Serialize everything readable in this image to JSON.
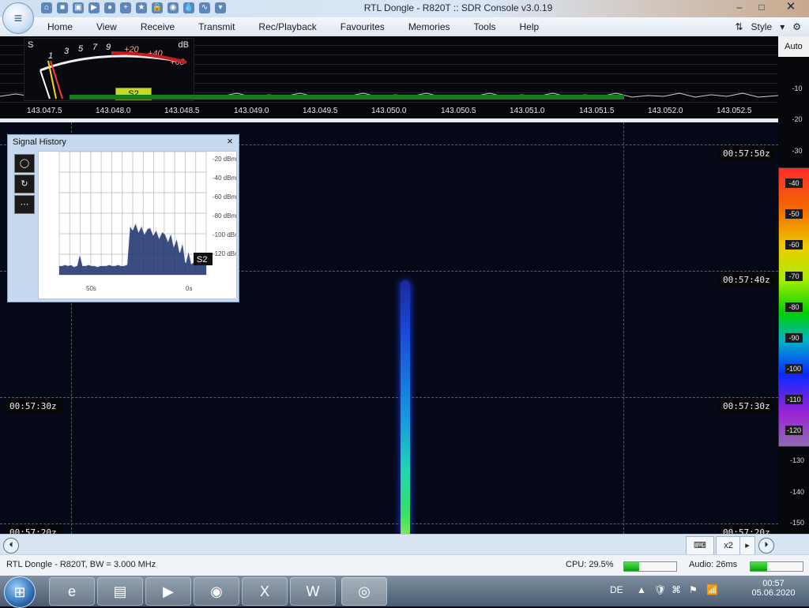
{
  "window": {
    "title": "RTL Dongle - R820T :: SDR Console v3.0.19",
    "min": "–",
    "max": "□",
    "close": "✕",
    "menu": [
      "Home",
      "View",
      "Receive",
      "Transmit",
      "Rec/Playback",
      "Favourites",
      "Memories",
      "Tools",
      "Help"
    ],
    "style_label": "Style"
  },
  "spectrum": {
    "smeter": {
      "s_label": "S",
      "db_label": "dB",
      "scale_left": [
        "1",
        "3",
        "5",
        "7",
        "9"
      ],
      "scale_right": [
        "+20",
        "+40",
        "+60"
      ],
      "badge": "S2"
    },
    "frequencies": [
      "143.047.5",
      "143.048.0",
      "143.048.5",
      "143.049.0",
      "143.049.5",
      "143.050.0",
      "143.050.5",
      "143.051.0",
      "143.051.5",
      "143.052.0",
      "143.052.5"
    ]
  },
  "signal_history": {
    "title": "Signal History",
    "close": "×",
    "buttons": [
      "◯",
      "↻",
      "⋯"
    ],
    "chart_data": {
      "type": "line",
      "title": "",
      "x_top": [
        "50s",
        "0s"
      ],
      "x_bottom": [
        "50s",
        "0s"
      ],
      "y_labels": [
        "-20 dBm",
        "-40 dBm",
        "-60 dBm",
        "-80 dBm",
        "-100 dBm",
        "-120 dBm"
      ],
      "badge": "S2",
      "ylim": [
        -130,
        -10
      ],
      "series": [
        {
          "values": [
            -121,
            -121,
            -120,
            -121,
            -120,
            -122,
            -121,
            -109,
            -121,
            -121,
            -120,
            -121,
            -121,
            -122,
            -121,
            -121,
            -121,
            -120,
            -121,
            -121,
            -120,
            -121,
            -121,
            -120,
            -82,
            -86,
            -79,
            -88,
            -82,
            -90,
            -85,
            -84,
            -91,
            -86,
            -94,
            -88,
            -90,
            -97,
            -89,
            -102,
            -94,
            -108,
            -98,
            -118,
            -106,
            -119,
            -117,
            -118,
            -119,
            -118,
            -120
          ]
        }
      ]
    }
  },
  "ruler": {
    "auto": "Auto",
    "ticks": [
      "-10",
      "-20",
      "-30",
      "-130",
      "-140",
      "-150"
    ],
    "color_labels": [
      "-40",
      "-50",
      "-60",
      "-70",
      "-80",
      "-90",
      "-100",
      "-110",
      "-120"
    ]
  },
  "waterfall": {
    "timestamps": [
      "00:57:50z",
      "00:57:40z",
      "00:57:30z",
      "00:57:20z"
    ]
  },
  "transport": {
    "left_button": "⏴",
    "keyboard": "⌨",
    "zoom": "x2",
    "right_arrow": "▸",
    "right_button": "⏵"
  },
  "status": {
    "device": "RTL Dongle - R820T, BW = 3.000 MHz",
    "cpu_label": "CPU: 29.5%",
    "cpu_level": 0.295,
    "audio_label": "Audio: 26ms",
    "audio_level": 0.32
  },
  "taskbar": {
    "lang": "DE",
    "time": "00:57",
    "date": "05.06.2020",
    "apps": [
      "Internet Explorer",
      "File Explorer",
      "Media Player",
      "Chrome",
      "Excel",
      "Word",
      "SDR Console"
    ],
    "tray_icons": [
      "▲",
      "🛡",
      "⌘",
      "⚑",
      "📶"
    ]
  }
}
